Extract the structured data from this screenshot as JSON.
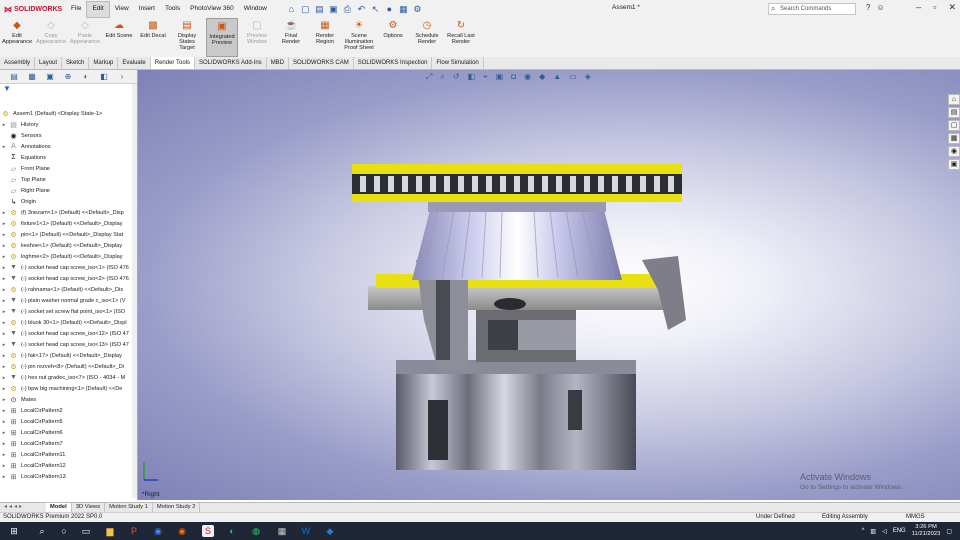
{
  "app": {
    "logo": "SOLIDWORKS",
    "document_title": "Assem1 *",
    "search_placeholder": "Search Commands",
    "menus": [
      "File",
      "Edit",
      "View",
      "Insert",
      "Tools",
      "PhotoView 360",
      "Window"
    ],
    "active_menu": "Edit"
  },
  "ribbon": {
    "buttons": [
      {
        "label": "Edit Appearance",
        "enabled": true,
        "icon": "appearance-icon"
      },
      {
        "label": "Copy Appearance",
        "enabled": false,
        "icon": "copy-appearance-icon"
      },
      {
        "label": "Paste Appearance",
        "enabled": false,
        "icon": "paste-appearance-icon"
      },
      {
        "label": "Edit Scene",
        "enabled": true,
        "icon": "scene-icon"
      },
      {
        "label": "Edit Decal",
        "enabled": true,
        "icon": "decal-icon"
      },
      {
        "label": "Display States Target",
        "enabled": true,
        "icon": "display-states-icon"
      },
      {
        "label": "Integrated Preview",
        "enabled": true,
        "pressed": true,
        "icon": "integrated-preview-icon"
      },
      {
        "label": "Preview Window",
        "enabled": false,
        "icon": "preview-window-icon"
      },
      {
        "label": "Final Render",
        "enabled": true,
        "icon": "final-render-icon"
      },
      {
        "label": "Render Region",
        "enabled": true,
        "icon": "render-region-icon"
      },
      {
        "label": "Scene Illumination Proof Sheet",
        "enabled": true,
        "icon": "illumination-icon"
      },
      {
        "label": "Options",
        "enabled": true,
        "icon": "options-icon"
      },
      {
        "label": "Schedule Render",
        "enabled": true,
        "icon": "schedule-icon"
      },
      {
        "label": "Recall Last Render",
        "enabled": true,
        "icon": "recall-icon"
      }
    ]
  },
  "command_tabs": {
    "items": [
      "Assembly",
      "Layout",
      "Sketch",
      "Markup",
      "Evaluate",
      "Render Tools",
      "SOLIDWORKS Add-Ins",
      "MBD",
      "SOLIDWORKS CAM",
      "SOLIDWORKS Inspection",
      "Flow Simulation"
    ],
    "active": "Render Tools"
  },
  "feature_tree": {
    "root": "Assem1 (Default) <Display State-1>",
    "items": [
      {
        "label": "History",
        "icon": "history-icon",
        "expander": "+"
      },
      {
        "label": "Sensors",
        "icon": "sensor-icon",
        "expander": ""
      },
      {
        "label": "Annotations",
        "icon": "annotations-icon",
        "expander": "+"
      },
      {
        "label": "Equations",
        "icon": "equations-icon",
        "expander": ""
      },
      {
        "label": "Front Plane",
        "icon": "plane-icon",
        "expander": ""
      },
      {
        "label": "Top Plane",
        "icon": "plane-icon",
        "expander": ""
      },
      {
        "label": "Right Plane",
        "icon": "plane-icon",
        "expander": ""
      },
      {
        "label": "Origin",
        "icon": "origin-icon",
        "expander": ""
      },
      {
        "label": "(f) 3nezam<1> (Default) <<Default>_Disp",
        "icon": "part-icon",
        "expander": "+"
      },
      {
        "label": "fixture1<1> (Default) <<Default>_Display",
        "icon": "part-icon",
        "expander": "+"
      },
      {
        "label": "pin<1> (Default) <<Default>_Display Stat",
        "icon": "part-icon",
        "expander": "+"
      },
      {
        "label": "keshoe<1> (Default) <<Default>_Display",
        "icon": "part-icon",
        "expander": "+"
      },
      {
        "label": "loghme<2> (Default) <<Default>_Display",
        "icon": "part-icon",
        "expander": "+"
      },
      {
        "label": "(-) socket head cap screw_iso<1> (ISO 476",
        "icon": "screw-icon",
        "expander": "+"
      },
      {
        "label": "(-) socket head cap screw_iso<2> (ISO 476",
        "icon": "screw-icon",
        "expander": "+"
      },
      {
        "label": "(-) rahnama<1> (Default) <<Default>_Dis",
        "icon": "part-icon",
        "expander": "+"
      },
      {
        "label": "(-) plain washer normal grade c_iso<1> (V",
        "icon": "screw-icon",
        "expander": "+"
      },
      {
        "label": "(-) socket set screw flat point_iso<1> (ISO",
        "icon": "screw-icon",
        "expander": "+"
      },
      {
        "label": "(-) bluok 30<1> (Default) <<Default>_Displ",
        "icon": "part-icon",
        "expander": "+"
      },
      {
        "label": "(-) socket head cap screw_iso<12> (ISO 47",
        "icon": "screw-icon",
        "expander": "+"
      },
      {
        "label": "(-) socket head cap screw_iso<13> (ISO 47",
        "icon": "screw-icon",
        "expander": "+"
      },
      {
        "label": "(-) fak<17> (Default) <<Default>_Display",
        "icon": "part-icon",
        "expander": "+"
      },
      {
        "label": "(-) pin rezveh<8> (Default) <<Default>_Di",
        "icon": "part-icon",
        "expander": "+"
      },
      {
        "label": "(-) hex nut gradec_iso<7> (ISO - 4034 - M",
        "icon": "screw-icon",
        "expander": "+"
      },
      {
        "label": "(-) bpw big machining<1> (Default) <<De",
        "icon": "part-icon",
        "expander": "+"
      },
      {
        "label": "Mates",
        "icon": "mates-icon",
        "expander": "+"
      },
      {
        "label": "LocalCirPattern2",
        "icon": "pattern-icon",
        "expander": "+"
      },
      {
        "label": "LocalCirPattern5",
        "icon": "pattern-icon",
        "expander": "+"
      },
      {
        "label": "LocalCirPattern6",
        "icon": "pattern-icon",
        "expander": "+"
      },
      {
        "label": "LocalCirPattern7",
        "icon": "pattern-icon",
        "expander": "+"
      },
      {
        "label": "LocalCirPattern11",
        "icon": "pattern-icon",
        "expander": "+"
      },
      {
        "label": "LocalCirPattern12",
        "icon": "pattern-icon",
        "expander": "+"
      },
      {
        "label": "LocalCirPattern13",
        "icon": "pattern-icon",
        "expander": "+"
      }
    ]
  },
  "viewport": {
    "view_label": "*Right",
    "watermark_title": "Activate Windows",
    "watermark_sub": "Go to Settings to activate Windows."
  },
  "bottom_tabs": {
    "items": [
      "Model",
      "3D Views",
      "Motion Study 1",
      "Motion Study 2"
    ],
    "active": "Model"
  },
  "status": {
    "product": "SOLIDWORKS Premium 2022 SP0.0",
    "state": "Under Defined",
    "mode": "Editing Assembly",
    "units": "MMGS"
  },
  "taskbar": {
    "language": "ENG",
    "time": "3:26 PM",
    "date": "11/21/2023"
  },
  "colors": {
    "accent_yellow": "#e8e010",
    "brand_red": "#c8102e",
    "taskbar_bg": "#1f2635"
  }
}
